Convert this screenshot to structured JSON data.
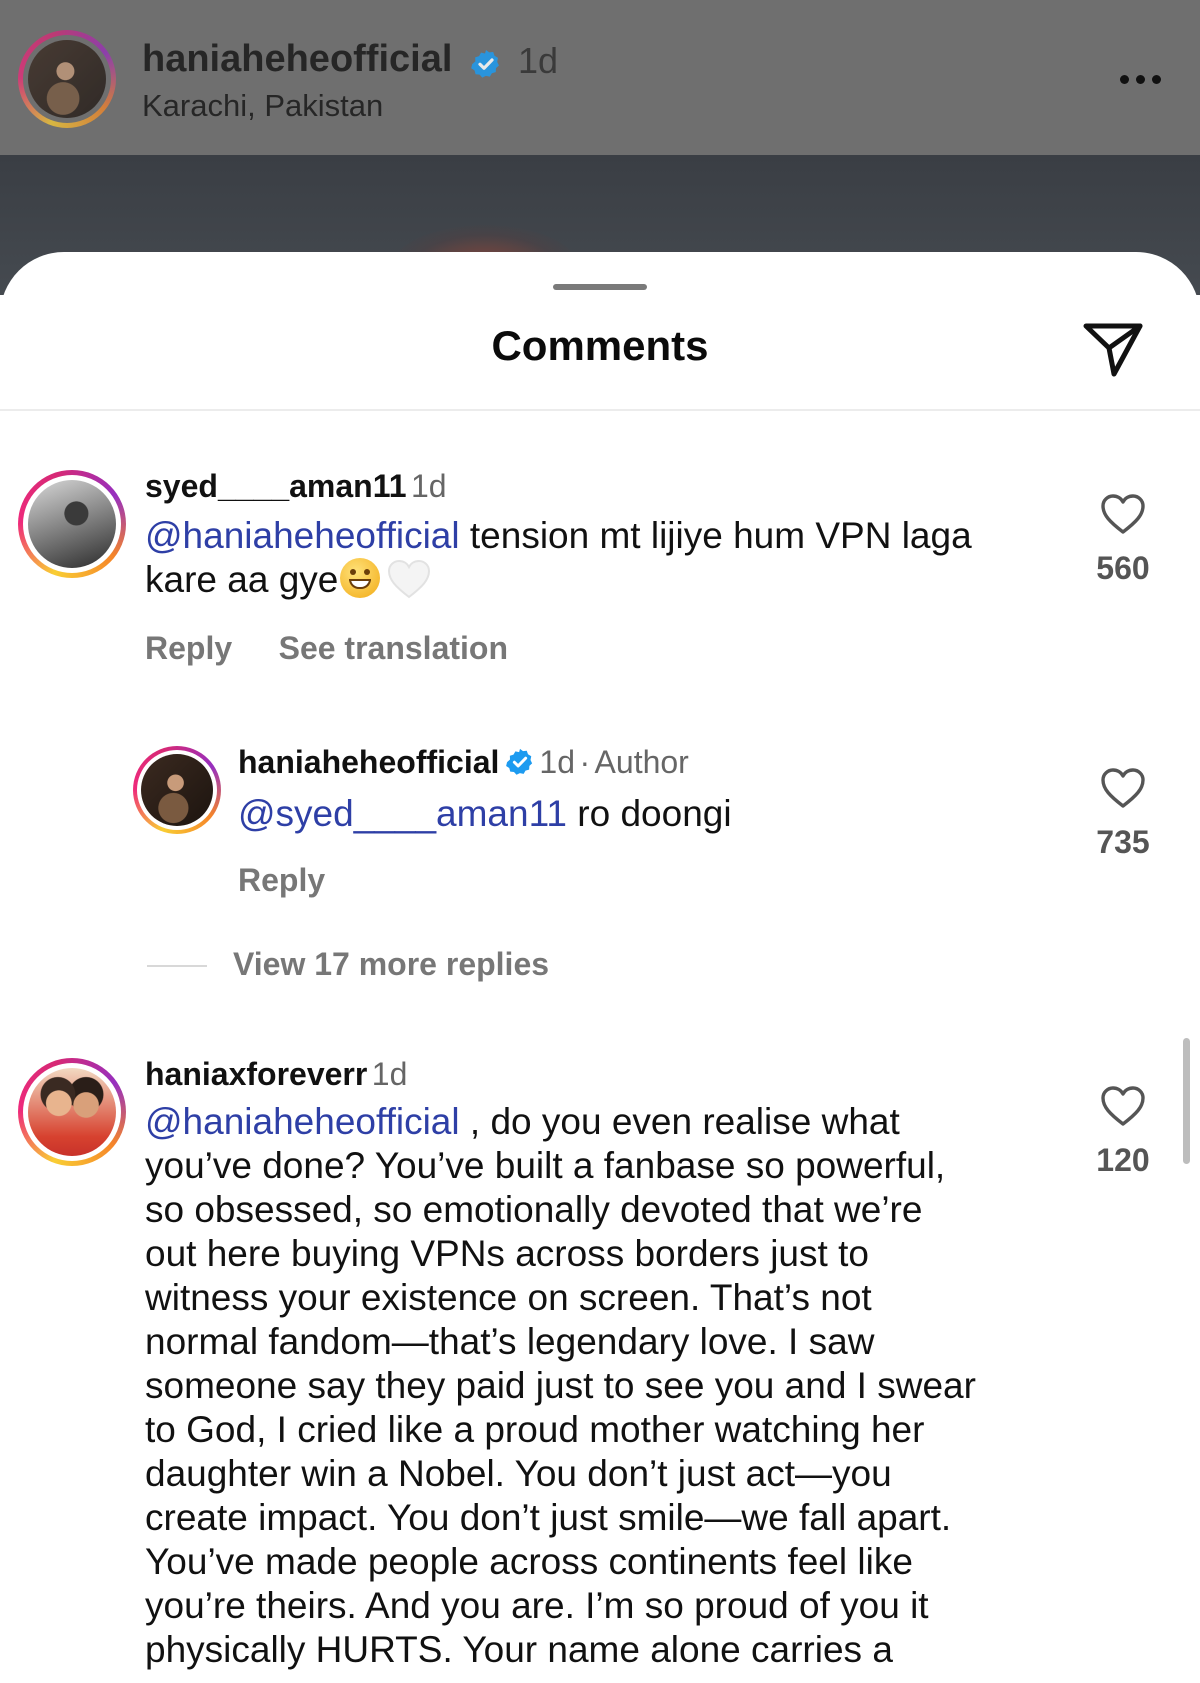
{
  "post_header": {
    "username": "haniaheheofficial",
    "time": "1d",
    "location": "Karachi, Pakistan",
    "more_icon": "more-horizontal-icon"
  },
  "sheet": {
    "title": "Comments",
    "share_icon": "paper-plane-icon"
  },
  "comments": [
    {
      "username": "syed____aman11",
      "time": "1d",
      "mention": "@haniaheheofficial",
      "text_line1": " tension mt lijiye hum VPN laga",
      "text_line2": "kare aa gye",
      "emojis": [
        "grinning-face-emoji",
        "white-heart-emoji"
      ],
      "reply_label": "Reply",
      "translation_label": "See translation",
      "likes": "560"
    },
    {
      "username": "haniaxforeverr",
      "time": "1d",
      "mention": "@haniaheheofficial",
      "first_line_rest": " , do you even realise what",
      "lines": [
        "you’ve done? You’ve built a fanbase so powerful,",
        "so obsessed, so emotionally devoted that we’re",
        "out here buying VPNs across borders just to",
        "witness your existence on screen. That’s not",
        "normal fandom—that’s legendary love. I saw",
        "someone say they paid just to see you and I swear",
        "to God, I cried like a proud mother watching her",
        "daughter win a Nobel. You don’t just act—you",
        "create impact. You don’t just smile—we fall apart.",
        "You’ve made people across continents feel like",
        "you’re theirs. And you are. I’m so proud of you it",
        "physically HURTS. Your name alone carries a"
      ],
      "likes": "120"
    }
  ],
  "reply": {
    "username": "haniaheheofficial",
    "time": "1d",
    "separator": "·",
    "author_label": "Author",
    "mention": "@syed____aman11",
    "text": " ro doongi",
    "reply_label": "Reply",
    "likes": "735"
  },
  "view_more": "View 17 more replies",
  "colors": {
    "mention": "#2e3fa6",
    "verified": "#1d9bf0",
    "secondary_text": "#777777"
  }
}
